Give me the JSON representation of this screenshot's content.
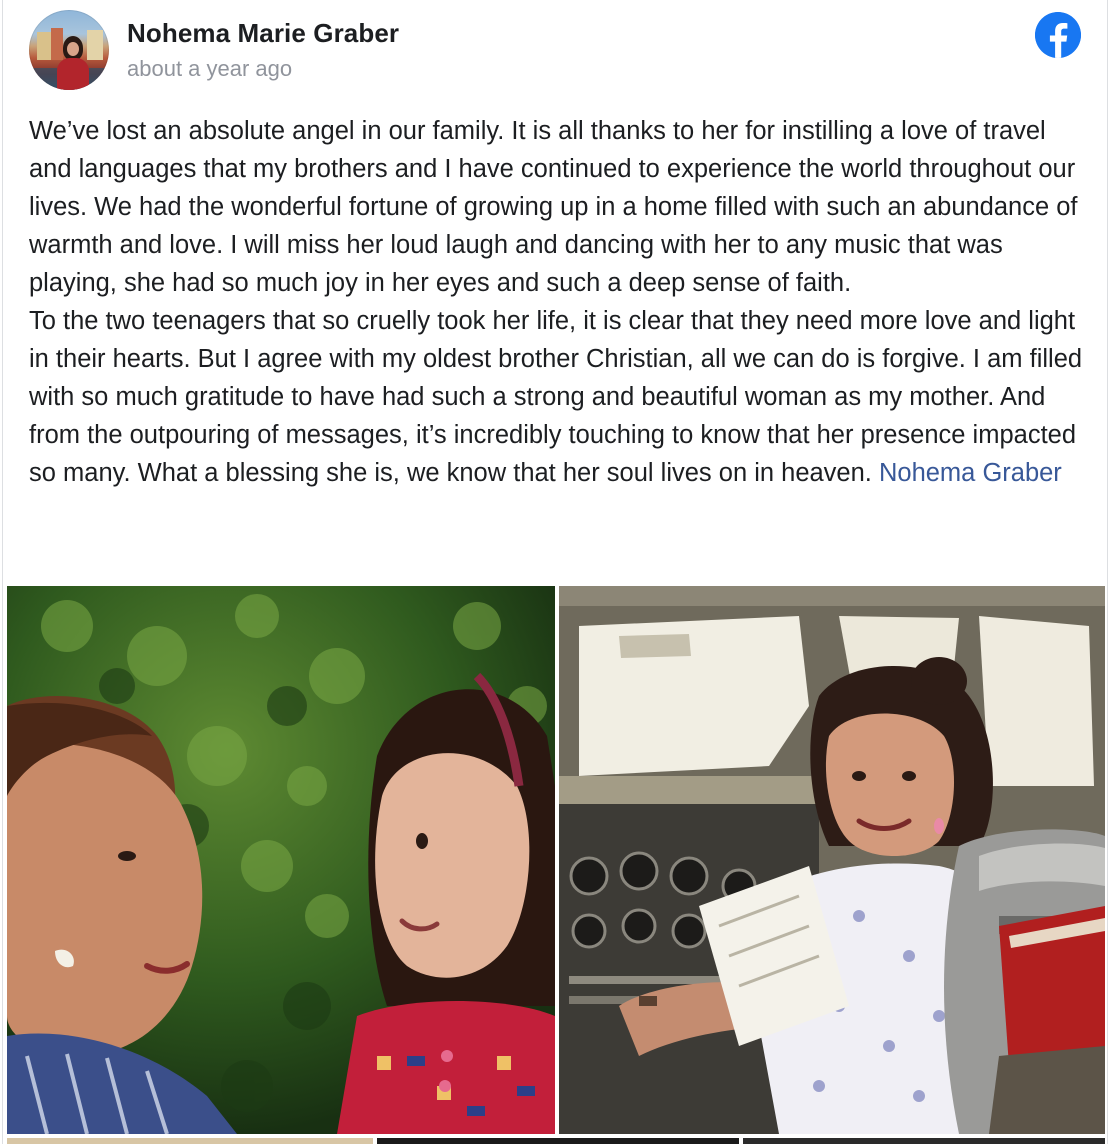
{
  "post": {
    "author_name": "Nohema Marie Graber",
    "timestamp": "about a year ago",
    "paragraph_1": "We’ve lost an absolute angel in our family. It is all thanks to her for instilling a love of travel and languages that my brothers and I have continued to experience the world throughout our lives. We had the wonderful fortune of growing up in a home filled with such an abundance of warmth and love. I will miss her loud laugh and dancing with her to any music that was playing, she had so much joy in her eyes and such a deep sense of faith.",
    "paragraph_2": "To the two teenagers that so cruelly took her life, it is clear that they need more love and light in their hearts. But I agree with my oldest brother Christian, all we can do is forgive. I am filled with so much gratitude to have had such a strong and beautiful woman as my mother. And from the outpouring of messages, it’s incredibly touching to know that her presence impacted so many. What a blessing she is, we know that her soul lives on in heaven. ",
    "mention": "Nohema Graber"
  },
  "icons": {
    "platform_icon": "facebook-icon",
    "platform_color": "#1877f2",
    "mention_color": "#385898"
  },
  "photos": [
    {
      "name": "photo-mother-and-daughter"
    },
    {
      "name": "photo-woman-in-cockpit"
    }
  ]
}
